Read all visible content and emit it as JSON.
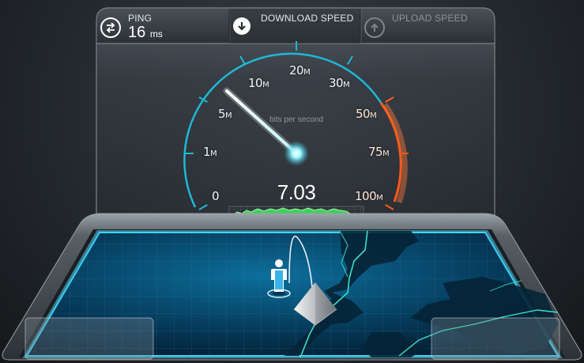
{
  "ping": {
    "label": "PING",
    "value": "16",
    "unit": "ms"
  },
  "download": {
    "label": "DOWNLOAD SPEED"
  },
  "upload": {
    "label": "UPLOAD SPEED"
  },
  "gauge": {
    "reading": "7.03",
    "unit_caption": "bits per second",
    "ticks": [
      {
        "num": "0",
        "suffix": ""
      },
      {
        "num": "1",
        "suffix": "M"
      },
      {
        "num": "5",
        "suffix": "M"
      },
      {
        "num": "10",
        "suffix": "M"
      },
      {
        "num": "20",
        "suffix": "M"
      },
      {
        "num": "30",
        "suffix": "M"
      },
      {
        "num": "50",
        "suffix": "M"
      },
      {
        "num": "75",
        "suffix": "M"
      },
      {
        "num": "100",
        "suffix": "M"
      }
    ],
    "colors": {
      "normal": "#1fb8d8",
      "high": "#ff5a1e"
    }
  },
  "icons": {
    "ping": "swap-arrows-icon",
    "download": "download-arrow-icon",
    "upload": "upload-arrow-icon",
    "user": "user-icon",
    "server": "server-pyramid-icon"
  }
}
